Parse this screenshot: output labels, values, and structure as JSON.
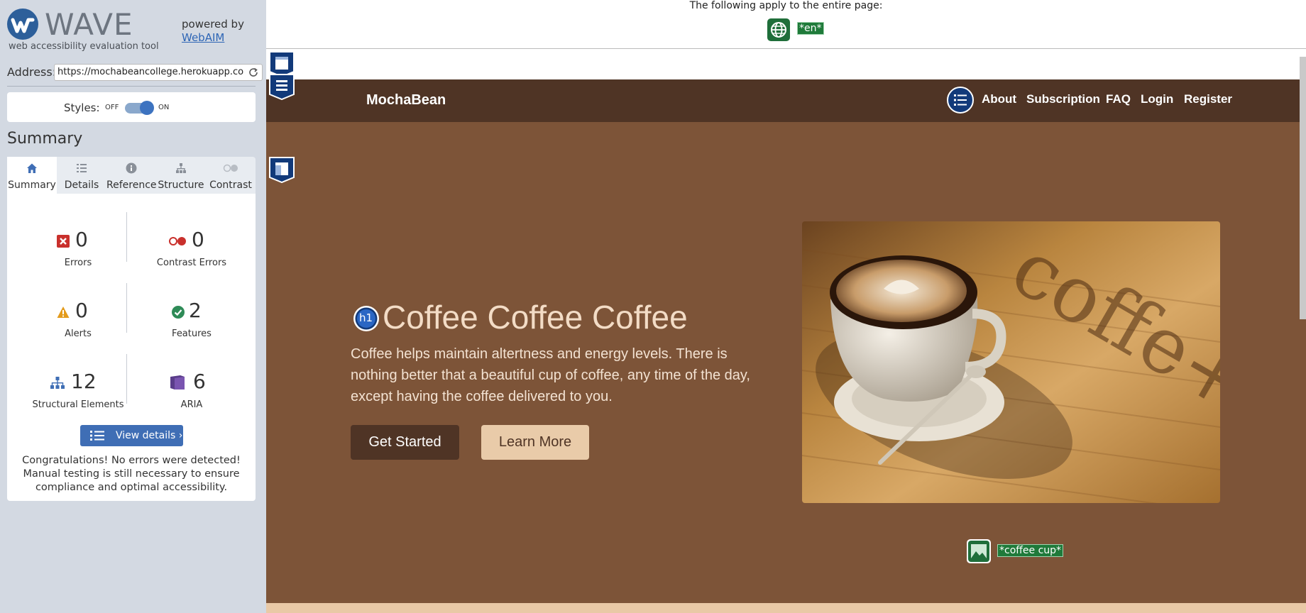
{
  "wave": {
    "logo_word": "WAVE",
    "logo_sub": "web accessibility evaluation tool",
    "powered_by": "powered by",
    "powered_link": "WebAIM",
    "address_label": "Address:",
    "address_value": "https://mochabeancollege.herokuapp.com/",
    "styles_label": "Styles:",
    "toggle_off": "OFF",
    "toggle_on": "ON",
    "summary_title": "Summary",
    "tabs": [
      {
        "label": "Summary",
        "icon": "home-icon"
      },
      {
        "label": "Details",
        "icon": "list-icon"
      },
      {
        "label": "Reference",
        "icon": "info-icon"
      },
      {
        "label": "Structure",
        "icon": "hierarchy-icon"
      },
      {
        "label": "Contrast",
        "icon": "contrast-icon"
      }
    ],
    "stats": {
      "errors": {
        "value": "0",
        "label": "Errors"
      },
      "contrast_errors": {
        "value": "0",
        "label": "Contrast Errors"
      },
      "alerts": {
        "value": "0",
        "label": "Alerts"
      },
      "features": {
        "value": "2",
        "label": "Features"
      },
      "structural": {
        "value": "12",
        "label": "Structural Elements"
      },
      "aria": {
        "value": "6",
        "label": "ARIA"
      }
    },
    "view_details": "View details ›",
    "congrats": "Congratulations! No errors were detected! Manual testing is still necessary to ensure compliance and optimal accessibility."
  },
  "site": {
    "notice": "The following apply to the entire page:",
    "lang_label": "*en*",
    "brand": "MochaBean",
    "nav": [
      "About",
      "Subscription",
      "FAQ",
      "Login",
      "Register"
    ],
    "hero_title": "Coffee Coffee Coffee",
    "hero_text": "Coffee helps maintain altertness and energy levels. There is nothing better that a beautiful cup of coffee, any time of the day, except having the coffee delivered to you.",
    "btn_primary": "Get Started",
    "btn_secondary": "Learn More",
    "h1_badge": "h1",
    "img_alt_label": "*coffee cup*"
  },
  "colors": {
    "navbar": "#4f3425",
    "hero": "#7d5438",
    "wave_blue": "#3f6eb5",
    "feature_green": "#1f7a3a"
  }
}
